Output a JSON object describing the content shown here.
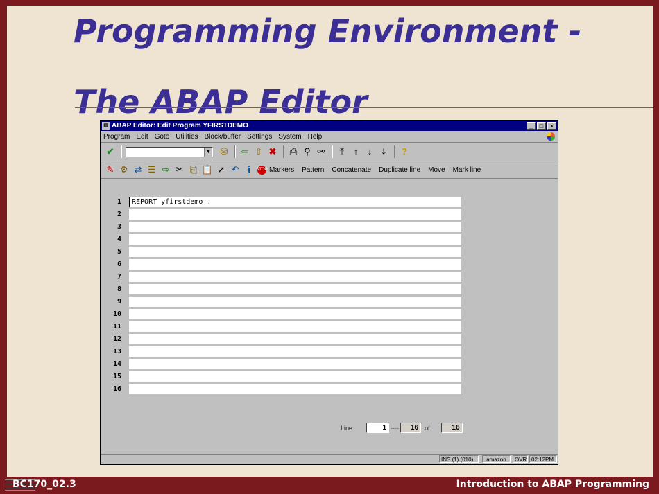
{
  "slide": {
    "title_line1": "Programming Environment -",
    "title_line2": "The ABAP Editor",
    "footer_left": "BC170_02.3",
    "footer_right": "Introduction to ABAP Programming",
    "logo_text": "SAP"
  },
  "window": {
    "title": "ABAP Editor: Edit Program YFIRSTDEMO",
    "controls": [
      "_",
      "□",
      "×"
    ]
  },
  "menu": [
    "Program",
    "Edit",
    "Goto",
    "Utilities",
    "Block/buffer",
    "Settings",
    "System",
    "Help"
  ],
  "command_field": {
    "value": ""
  },
  "toolbar_buttons": [
    "Markers",
    "Pattern",
    "Concatenate",
    "Duplicate line",
    "Move",
    "Mark line"
  ],
  "editor": {
    "lines": [
      {
        "num": "1",
        "code": "REPORT yfirstdemo ."
      },
      {
        "num": "2",
        "code": ""
      },
      {
        "num": "3",
        "code": ""
      },
      {
        "num": "4",
        "code": ""
      },
      {
        "num": "5",
        "code": ""
      },
      {
        "num": "6",
        "code": ""
      },
      {
        "num": "7",
        "code": ""
      },
      {
        "num": "8",
        "code": ""
      },
      {
        "num": "9",
        "code": ""
      },
      {
        "num": "10",
        "code": ""
      },
      {
        "num": "11",
        "code": ""
      },
      {
        "num": "12",
        "code": ""
      },
      {
        "num": "13",
        "code": ""
      },
      {
        "num": "14",
        "code": ""
      },
      {
        "num": "15",
        "code": ""
      },
      {
        "num": "16",
        "code": ""
      }
    ]
  },
  "line_info": {
    "label": "Line",
    "from": "1",
    "to": "16",
    "of_label": "of",
    "total": "16"
  },
  "status": {
    "session": "INS (1) (010)",
    "server": "amazon",
    "mode": "OVR",
    "time": "02:12PM"
  },
  "colors": {
    "slide_border": "#7a1a1f",
    "slide_bg": "#efe3d1",
    "title": "#3b2f96",
    "window_title": "#000080"
  }
}
